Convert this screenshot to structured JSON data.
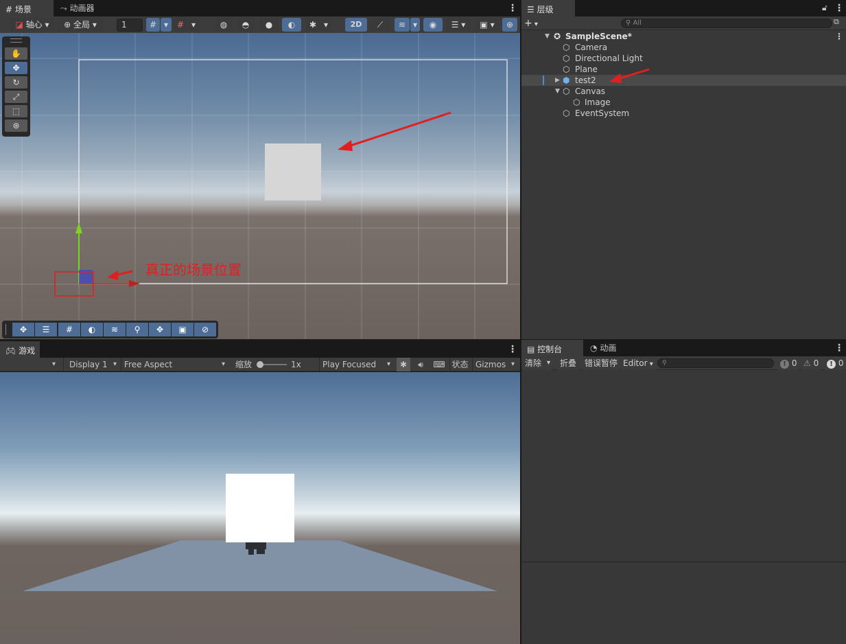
{
  "scene_panel": {
    "tabs": [
      {
        "label": "场景",
        "icon": "grid-icon"
      },
      {
        "label": "动画器",
        "icon": "animator-icon"
      }
    ],
    "toolbar": {
      "pivot_label": "轴心",
      "global_label": "全局",
      "grid_snap_value": "1",
      "toggle_2d_label": "2D"
    },
    "annotation_text": "真正的场景位置"
  },
  "hierarchy_panel": {
    "tab_label": "层级",
    "search_placeholder": "All",
    "scene_name": "SampleScene*",
    "items": [
      {
        "label": "Camera"
      },
      {
        "label": "Directional Light"
      },
      {
        "label": "Plane"
      },
      {
        "label": "test2"
      },
      {
        "label": "Canvas"
      },
      {
        "label": "Image"
      },
      {
        "label": "EventSystem"
      }
    ]
  },
  "game_panel": {
    "tab_label": "游戏",
    "toolbar": {
      "display_label": "Display 1",
      "aspect_label": "Free Aspect",
      "scale_label": "缩放",
      "scale_value": "1x",
      "play_mode_label": "Play Focused",
      "stats_label": "状态",
      "gizmos_label": "Gizmos"
    }
  },
  "console_panel": {
    "tabs": [
      {
        "label": "控制台"
      },
      {
        "label": "动画"
      }
    ],
    "toolbar": {
      "clear_label": "清除",
      "collapse_label": "折叠",
      "error_pause_label": "错误暂停",
      "editor_label": "Editor",
      "info_count": "0",
      "warning_count": "0",
      "error_count": "0"
    }
  },
  "colors": {
    "accent_blue": "#4d6d97",
    "annotation_red": "#e02020",
    "panel_bg": "#383838"
  }
}
